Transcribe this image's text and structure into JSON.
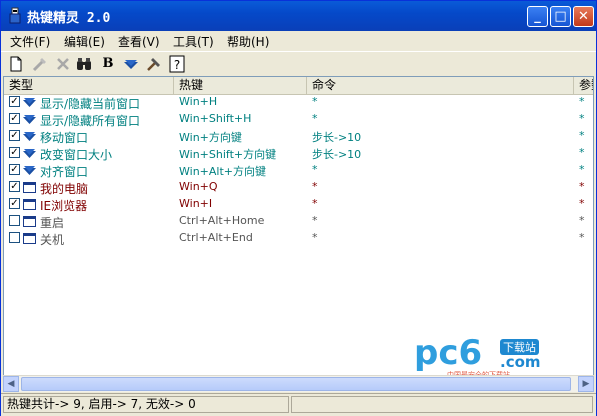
{
  "window": {
    "title": "热键精灵 2.0",
    "min_glyph": "_",
    "max_glyph": "□",
    "close_glyph": "✕"
  },
  "menu": [
    "文件(F)",
    "编辑(E)",
    "查看(V)",
    "工具(T)",
    "帮助(H)"
  ],
  "toolbar": {
    "new_icon": "new-file-icon",
    "edit_icon": "brush-icon",
    "delete_icon": "delete-x-icon",
    "find_icon": "binoculars-icon",
    "bold_label": "B",
    "down_icon": "down-arrow-icon",
    "tools_icon": "hammer-icon",
    "help_icon": "help-icon"
  },
  "columns": [
    "类型",
    "热键",
    "命令",
    "参数"
  ],
  "rows": [
    {
      "checked": true,
      "icon": "down-arrow-icon",
      "name": "显示/隐藏当前窗口",
      "key": "Win+H",
      "cmd": "*",
      "param": "*",
      "color": "teal"
    },
    {
      "checked": true,
      "icon": "down-arrow-icon",
      "name": "显示/隐藏所有窗口",
      "key": "Win+Shift+H",
      "cmd": "*",
      "param": "*",
      "color": "teal"
    },
    {
      "checked": true,
      "icon": "down-arrow-icon",
      "name": "移动窗口",
      "key": "Win+方向键",
      "cmd": "步长->10",
      "param": "*",
      "color": "teal"
    },
    {
      "checked": true,
      "icon": "down-arrow-icon",
      "name": "改变窗口大小",
      "key": "Win+Shift+方向键",
      "cmd": "步长->10",
      "param": "*",
      "color": "teal"
    },
    {
      "checked": true,
      "icon": "down-arrow-icon",
      "name": "对齐窗口",
      "key": "Win+Alt+方向键",
      "cmd": "*",
      "param": "*",
      "color": "teal"
    },
    {
      "checked": true,
      "icon": "window-icon",
      "name": "我的电脑",
      "key": "Win+Q",
      "cmd": "*",
      "param": "*",
      "color": "red"
    },
    {
      "checked": true,
      "icon": "window-icon",
      "name": "IE浏览器",
      "key": "Win+I",
      "cmd": "*",
      "param": "*",
      "color": "red"
    },
    {
      "checked": false,
      "icon": "window-icon",
      "name": "重启",
      "key": "Ctrl+Alt+Home",
      "cmd": "*",
      "param": "*",
      "color": "gray"
    },
    {
      "checked": false,
      "icon": "window-icon",
      "name": "关机",
      "key": "Ctrl+Alt+End",
      "cmd": "*",
      "param": "*",
      "color": "gray"
    }
  ],
  "status": {
    "text": "热键共计-> 9, 启用-> 7, 无效-> 0"
  },
  "watermark": {
    "big": "pc6",
    "badge": "下载站",
    "com": ".com",
    "slogan": "中国最安全的下载站"
  },
  "colors": {
    "teal": "#008080",
    "red": "#800000",
    "gray": "#555555",
    "title_bar": "#0549c9"
  }
}
